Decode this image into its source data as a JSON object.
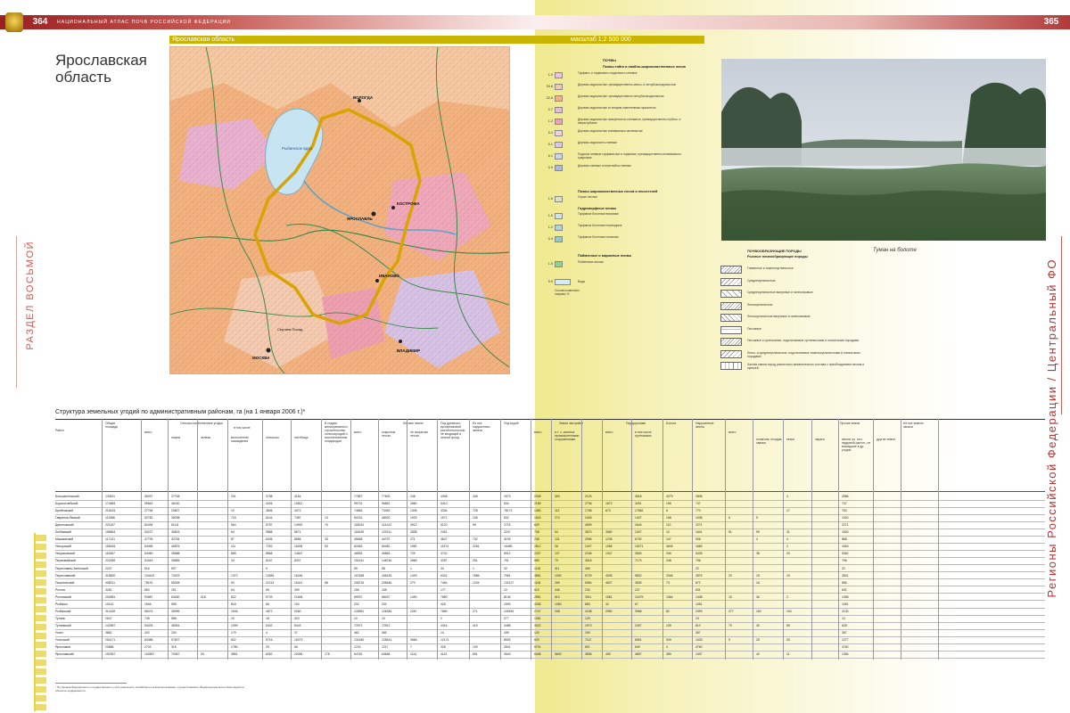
{
  "header": {
    "page_left": "364",
    "page_right": "365",
    "atlas_title": "НАЦИОНАЛЬНЫЙ АТЛАС ПОЧВ РОССИЙСКОЙ ФЕДЕРАЦИИ"
  },
  "region": {
    "title": "Ярославская область",
    "bar_left": "Ярославская область",
    "bar_right": "масштаб 1:2 500 000"
  },
  "side": {
    "section": "РАЗДЕЛ ВОСЬМОЙ",
    "regions": "Регионы Российской Федерации / Центральный ФО"
  },
  "map": {
    "cities": [
      "ВОЛОГДА",
      "Рыбинское вдхр.",
      "КОСТРОМА",
      "ЯРОСЛАВЛЬ",
      "ИВАНОВО",
      "ВЛАДИМИР",
      "МОСКВА",
      "Сергиев Посад"
    ]
  },
  "legend": {
    "title": "ПОЧВЫ",
    "group1": "Почвы тайги и хвойно-широколиственных лесов",
    "group2": "Почвы широколиственных лесов и лесостепей",
    "group3": "Гидроморфные почвы",
    "group4": "Пойменные и маршевые почвы",
    "items": [
      {
        "num": "1.0",
        "label": "Торфяно- и торфянисто-подзолисто-глеевые",
        "color": "#e9c3e3"
      },
      {
        "num": "34.8",
        "label": "Дерново-подзолистые, преимущественно мелко- и неглубокоподзолистые",
        "color": "#f4c9a8"
      },
      {
        "num": "32.8",
        "label": "Дерново-подзолистые, преимущественно неглубокоподзолистые",
        "color": "#f3b185"
      },
      {
        "num": "0.7",
        "label": "Дерново-подзолистые со вторым осветленным горизонтом",
        "color": "#f1b9c4"
      },
      {
        "num": "1.2",
        "label": "Дерново-подзолистые поверхностно-глееватые, преимущественно глубоко- и сверхглубокие",
        "color": "#ec9fb7"
      },
      {
        "num": "5.4",
        "label": "Дерново-подзолистые иллювиально-железистые",
        "color": "#f2d1dc"
      },
      {
        "num": "0.1",
        "label": "Дерново-подзолисто-глеевые",
        "color": "#d9c7ea"
      },
      {
        "num": "6.1",
        "label": "Подзолы глеевые торфянистые и торфяные, преимущественно иллювиально-гумусовые",
        "color": "#c9d5ef"
      },
      {
        "num": "0.9",
        "label": "Дерново-глеевые и перегнойно-глеевые",
        "color": "#a9bde4"
      },
      {
        "num": "1.6",
        "label": "Серые лесные",
        "color": "#e5e0b0"
      },
      {
        "num": "1.6",
        "label": "Торфяные болотные верховые",
        "color": "#c8e6e6"
      },
      {
        "num": "1.2",
        "label": "Торфяные болотные переходные",
        "color": "#a8d7d9"
      },
      {
        "num": "0.4",
        "label": "Торфяные болотные низинные",
        "color": "#8fcbc6"
      },
      {
        "num": "1.5",
        "label": "Пойменные кислые",
        "color": "#8fd18f"
      }
    ],
    "water_num": "9.9",
    "water_label": "Воды",
    "note": "Состав почвенного покрова, %"
  },
  "photo": {
    "caption": "Туман на болоте"
  },
  "rocks": {
    "title": "ПОЧВООБРАЗУЮЩИЕ ПОРОДЫ",
    "subtitle": "Рыхлые почвообразующие породы",
    "items": [
      "Глинистые и тяжелосуглинистые",
      "Среднесуглинистые",
      "Среднесуглинистые валунные и галечниковые",
      "Легкосуглинистые",
      "Легкосуглинистые валунные и галечниковые",
      "Песчаные",
      "Песчаные и супесчаные, подстилаемые суглинистыми и глинистыми породами",
      "Легко- и среднесуглинистые, подстилаемые тяжелосуглинистыми и глинистыми породами",
      "Частая смена пород различного механического состава с преобладанием песков и супесей"
    ]
  },
  "table": {
    "title": "Структура земельных угодий по административным районам, га (на 1 января 2006 г.)*",
    "headers": {
      "district": "Район",
      "total": "Общая площадь",
      "agri": "Сельскохозяйственные угодья",
      "agri_total": "всего",
      "incl": "в том числе",
      "arable": "пашня",
      "fallow": "залежь",
      "perennial": "многолетние насаждения",
      "hay": "сенокосы",
      "pasture": "пастбища",
      "construction": "В стадии мелиоративного строительства сельхозугодий и восстановления плодородия",
      "forest": "Лесные земли",
      "forest_total": "всего",
      "covered": "покрытые лесом",
      "uncovered": "не покрытые лесом",
      "shrub": "Под древесно-кустарниковой растительностью, не входящей в лесной фонд",
      "disturbed": "Из них нарушенных земель",
      "water": "Под водой",
      "swamps": "Земли застройки",
      "swamp_total": "всего",
      "swamp_a": "в т. ч. занятые промышленными сооружениями",
      "roads": "Под дорогами",
      "roads_total": "всего",
      "roads_a": "в том числе грунтовыми",
      "bogs": "Болота",
      "disturbed2": "Нарушенные земли",
      "other": "Прочие земли",
      "other_total": "всего",
      "o1": "полигоны отходов, свалки",
      "o2": "пески",
      "o3": "овраги",
      "o4": "земли, уч. на с прудовой растит., не вошедшие в др. угодия",
      "o5": "другие земли",
      "reserve": "Из них земель запаса"
    },
    "rows": [
      [
        "Большесельский",
        "133511",
        "35297",
        "27708",
        "",
        "201",
        "3758",
        "4164",
        "",
        "77857",
        "77609",
        "248",
        "4308",
        "335",
        "1573",
        "2308",
        "353",
        "2120",
        "",
        "3818",
        "4279",
        "2808",
        "",
        "",
        "4",
        "",
        "2586"
      ],
      [
        "Борисоглебский",
        "174883",
        "59661",
        "46430",
        "",
        "",
        "4426",
        "10811",
        "",
        "99701",
        "96851",
        "2860",
        "5410",
        "",
        "834",
        "2189",
        "",
        "2736",
        "1872",
        "3491",
        "155",
        "747",
        "",
        "",
        "",
        "",
        "747"
      ],
      [
        "Брейтовский",
        "215415",
        "27764",
        "20827",
        "",
        "10",
        "3846",
        "4072",
        "",
        "74654",
        "73349",
        "1305",
        "3334",
        "728",
        "78173",
        "1383",
        "112",
        "1758",
        "673",
        "17682",
        "6",
        "770",
        "",
        "",
        "17",
        "",
        "753"
      ],
      [
        "Гаврилов-Ямский",
        "111986",
        "52782",
        "39298",
        "",
        "716",
        "6144",
        "7487",
        "13",
        "50231",
        "48302",
        "1929",
        "1571",
        "106",
        "832",
        "1518",
        "273",
        "2405",
        "",
        "1407",
        "108",
        "1038",
        "6",
        "5",
        "",
        "",
        "1020"
      ],
      [
        "Даниловский",
        "221157",
        "82454",
        "61111",
        "",
        "564",
        "5787",
        "14992",
        "76",
        "118034",
        "114122",
        "3912",
        "5120",
        "55",
        "2715",
        "829",
        "",
        "4899",
        "",
        "2646",
        "113",
        "2271",
        "",
        "",
        "",
        "",
        "2271"
      ],
      [
        "Любимский",
        "198663",
        "53227",
        "35503",
        "",
        "64",
        "9888",
        "8571",
        "",
        "118049",
        "120211",
        "2838",
        "2451",
        "",
        "2247",
        "708",
        "64",
        "3870",
        "3080",
        "2407",
        "10",
        "1641",
        "51",
        "59",
        "31",
        "",
        "1500"
      ],
      [
        "Мышкинский",
        "117131",
        "47793",
        "32754",
        "",
        "87",
        "6336",
        "8656",
        "33",
        "45648",
        "44797",
        "271",
        "3627",
        "732",
        "4193",
        "236",
        "121",
        "2956",
        "1235",
        "6792",
        "147",
        "906",
        "",
        "4",
        "4",
        "",
        "868"
      ],
      [
        "Некоузский",
        "155445",
        "64065",
        "45875",
        "",
        "111",
        "7252",
        "11828",
        "53",
        "82463",
        "80482",
        "1981",
        "11574",
        "2281",
        "16489",
        "2812",
        "26",
        "2407",
        "1066",
        "15271",
        "4645",
        "1665",
        "",
        "",
        "2",
        "",
        "1663"
      ],
      [
        "Некрасовский",
        "116367",
        "64060",
        "39688",
        "",
        "865",
        "8868",
        "14647",
        "",
        "46592",
        "45863",
        "729",
        "3742",
        "",
        "6912",
        "2207",
        "137",
        "2185",
        "1347",
        "3853",
        "206",
        "5428",
        "",
        "38",
        "20",
        "",
        "5362"
      ],
      [
        "Первомайский",
        "222069",
        "54343",
        "39855",
        "",
        "34",
        "6167",
        "8307",
        "",
        "151611",
        "148746",
        "2865",
        "3257",
        "251",
        "751",
        "589",
        "79",
        "3516",
        "",
        "7179",
        "248",
        "796",
        "",
        "",
        "",
        "",
        "796"
      ],
      [
        "Переславль-Залесский",
        "2247",
        "516",
        "507",
        "",
        "",
        "9",
        "",
        "",
        "59",
        "58",
        "1",
        "34",
        "1",
        "32",
        "1118",
        "411",
        "465",
        "",
        "",
        "",
        "22",
        "",
        "",
        "",
        "",
        "22"
      ],
      [
        "Переславский",
        "318820",
        "104422",
        "74223",
        "",
        "1372",
        "12581",
        "16246",
        "",
        "167638",
        "166145",
        "1493",
        "6341",
        "1586",
        "7981",
        "3861",
        "1040",
        "5729",
        "4005",
        "9822",
        "2345",
        "2875",
        "20",
        "15",
        "19",
        "",
        "2821"
      ],
      [
        "Пошехонский",
        "408011",
        "78191",
        "55308",
        "",
        "93",
        "11313",
        "11541",
        "68",
        "208716",
        "208446",
        "270",
        "7454",
        "1204",
        "132127",
        "1106",
        "269",
        "6964",
        "4607",
        "3839",
        "74",
        "872",
        "",
        "16",
        "",
        "",
        "856"
      ],
      [
        "Ростов",
        "3281",
        "863",
        "251",
        "",
        "64",
        "55",
        "399",
        "",
        "155",
        "155",
        "",
        "177",
        "",
        "10",
        "819",
        "446",
        "230",
        "",
        "237",
        "",
        "631",
        "",
        "",
        "",
        "",
        "631"
      ],
      [
        "Ростовский",
        "204981",
        "93987",
        "63430",
        "318",
        "822",
        "9743",
        "21694",
        "",
        "69937",
        "68437",
        "1490",
        "7850",
        "",
        "8134",
        "2951",
        "610",
        "3911",
        "1981",
        "12479",
        "1364",
        "1408",
        "15",
        "36",
        "2",
        "",
        "1355"
      ],
      [
        "Рыбинск",
        "10142",
        "1546",
        "558",
        "",
        "818",
        "66",
        "104",
        "",
        "232",
        "232",
        "",
        "425",
        "",
        "1593",
        "4335",
        "1083",
        "883",
        "32",
        "67",
        "",
        "1051",
        "",
        "",
        "",
        "",
        "1051"
      ],
      [
        "Рыбинский",
        "314169",
        "55474",
        "35996",
        "",
        "1946",
        "4872",
        "9260",
        "",
        "128551",
        "126284",
        "2267",
        "7869",
        "271",
        "109454",
        "2747",
        "208",
        "4158",
        "2080",
        "3968",
        "82",
        "2393",
        "277",
        "182",
        "104",
        "",
        "2130"
      ],
      [
        "Тутаев",
        "2547",
        "745",
        "588",
        "",
        "15",
        "18",
        "323",
        "",
        "10",
        "10",
        "",
        "2",
        "",
        "277",
        "1361",
        "",
        "129",
        "",
        "",
        "",
        "23",
        "",
        "",
        "",
        "",
        "13"
      ],
      [
        "Тутаевский",
        "142587",
        "54325",
        "38351",
        "",
        "1099",
        "6432",
        "8443",
        "",
        "72972",
        "72912",
        "",
        "4316",
        "419",
        "3488",
        "3322",
        "",
        "1973",
        "",
        "2267",
        "128",
        "810",
        "70",
        "30",
        "85",
        "",
        "628"
      ],
      [
        "Углич",
        "3862",
        "420",
        "200",
        "",
        "179",
        "4",
        "37",
        "",
        "482",
        "482",
        "",
        "14",
        "",
        "439",
        "120",
        "",
        "190",
        "",
        "",
        "",
        "357",
        "",
        "",
        "",
        "",
        "357"
      ],
      [
        "Угличский",
        "254171",
        "83388",
        "57807",
        "",
        "502",
        "9716",
        "15273",
        "",
        "132180",
        "128514",
        "3666",
        "12174",
        "",
        "8525",
        "829",
        "",
        "7112",
        "",
        "6561",
        "349",
        "1333",
        "5",
        "25",
        "26",
        "",
        "1277"
      ],
      [
        "Ярославль",
        "20588",
        "2703",
        "318",
        "",
        "1780",
        "29",
        "56",
        "",
        "1224",
        "1217",
        "7",
        "328",
        "109",
        "2831",
        "8701",
        "",
        "801",
        "",
        "649",
        "4",
        "4760",
        "",
        "",
        "",
        "",
        "4760"
      ],
      [
        "Ярославский",
        "192357",
        "102837",
        "70357",
        "93",
        "3851",
        "6352",
        "20284",
        "175",
        "64762",
        "63648",
        "1114",
        "4113",
        "691",
        "3543",
        "6408",
        "3640",
        "3806",
        "409",
        "4807",
        "359",
        "1407",
        "",
        "42",
        "11",
        "",
        "1354"
      ]
    ],
    "footnote": "* По данным Федерального государственного учета земельного хозяйства на землепользовании, осуществляемого Федеральным агентством кадастра объектов недвижимости."
  }
}
